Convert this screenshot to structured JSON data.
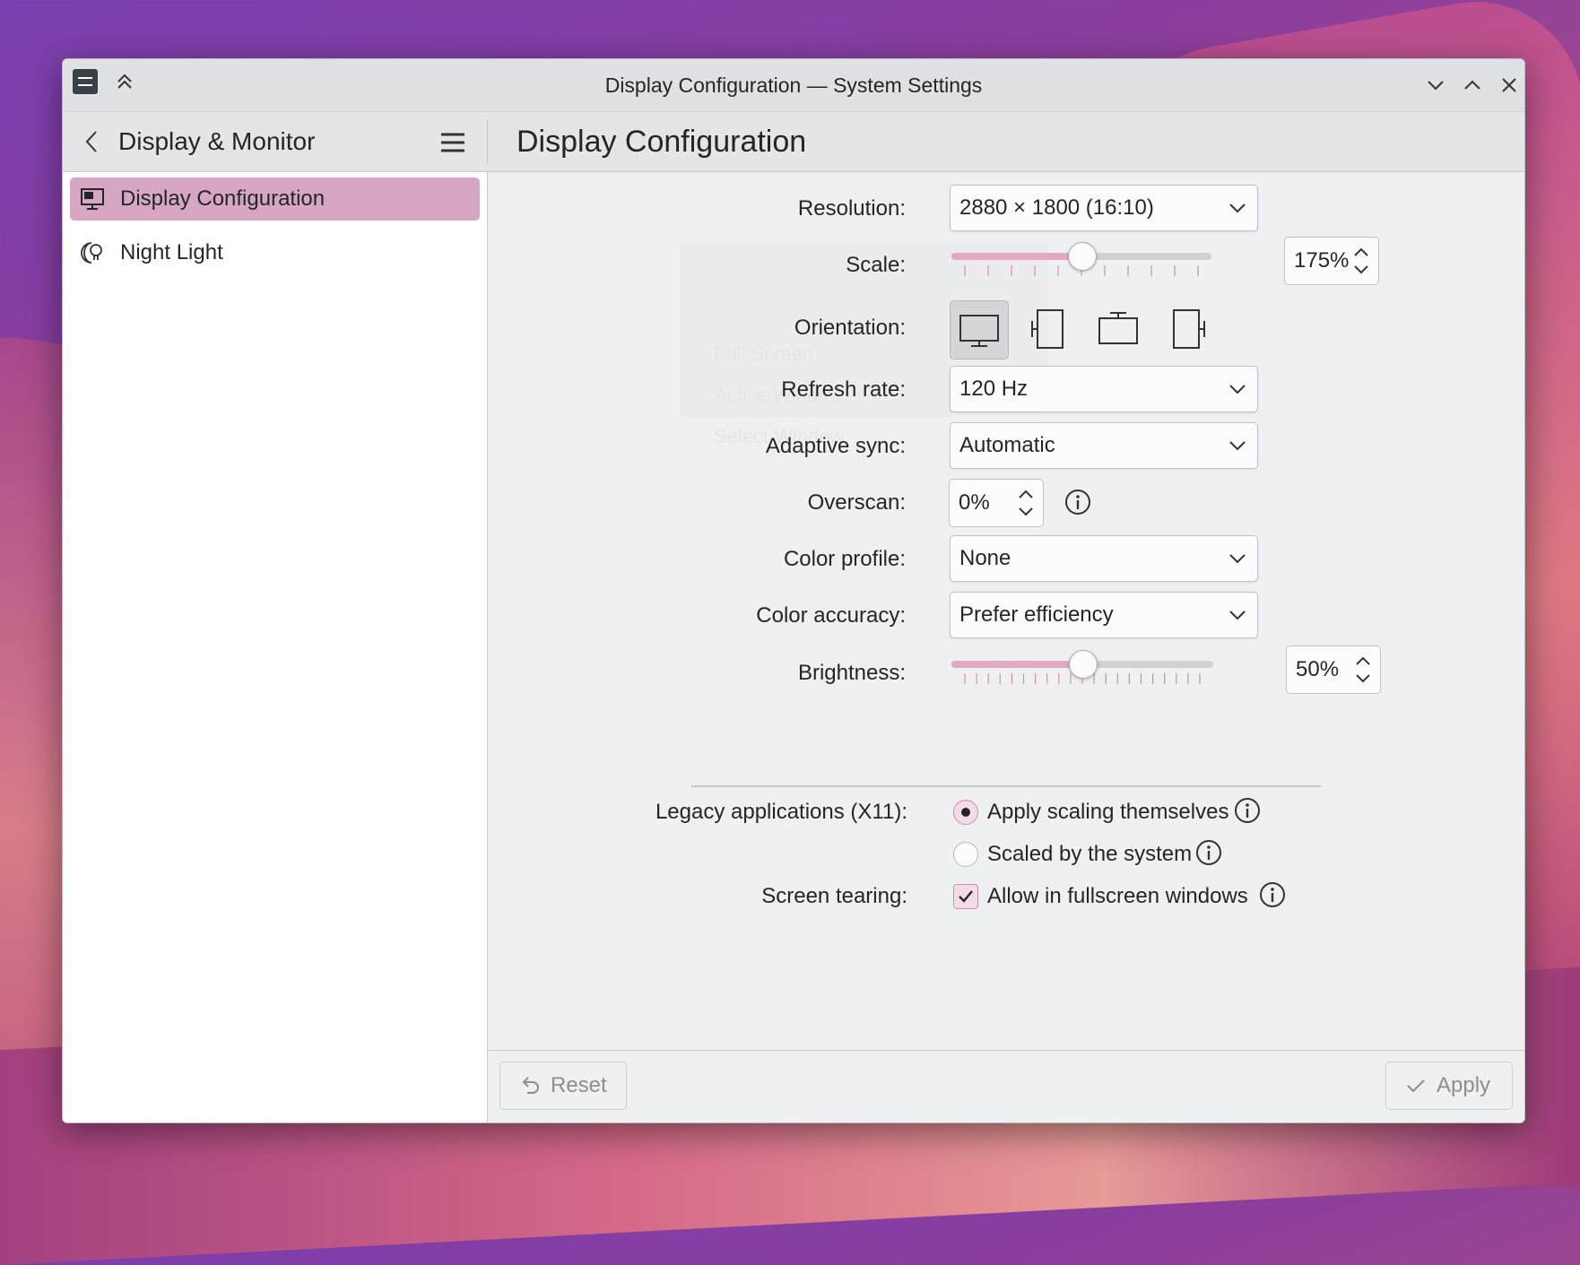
{
  "window": {
    "title": "Display Configuration — System Settings"
  },
  "header": {
    "back_title": "Display & Monitor",
    "page_title": "Display Configuration"
  },
  "sidebar": {
    "items": [
      {
        "label": "Display Configuration",
        "icon": "monitor-icon",
        "active": true
      },
      {
        "label": "Night Light",
        "icon": "night-light-icon",
        "active": false
      }
    ]
  },
  "settings": {
    "resolution": {
      "label": "Resolution:",
      "value": "2880 × 1800 (16:10)"
    },
    "scale": {
      "label": "Scale:",
      "value": "175%",
      "fraction": 0.5
    },
    "orientation": {
      "label": "Orientation:",
      "options": [
        "landscape",
        "portrait-left",
        "landscape-flipped",
        "portrait-right"
      ],
      "selected": "landscape"
    },
    "refresh_rate": {
      "label": "Refresh rate:",
      "value": "120 Hz"
    },
    "adaptive_sync": {
      "label": "Adaptive sync:",
      "value": "Automatic"
    },
    "overscan": {
      "label": "Overscan:",
      "value": "0%"
    },
    "color_profile": {
      "label": "Color profile:",
      "value": "None"
    },
    "color_accuracy": {
      "label": "Color accuracy:",
      "value": "Prefer efficiency"
    },
    "brightness": {
      "label": "Brightness:",
      "value": "50%",
      "fraction": 0.5
    },
    "legacy_apps": {
      "label": "Legacy applications (X11):",
      "options": [
        "Apply scaling themselves",
        "Scaled by the system"
      ],
      "selected": "Apply scaling themselves"
    },
    "screen_tearing": {
      "label": "Screen tearing:",
      "option": "Allow in fullscreen windows",
      "checked": true
    }
  },
  "footer": {
    "reset_label": "Reset",
    "apply_label": "Apply"
  },
  "ghost_menu": [
    "Full Screen",
    "Active Window",
    "Select Window"
  ],
  "colors": {
    "accent": "#d7a6c2",
    "slider_fill": "#e2a8c5"
  }
}
